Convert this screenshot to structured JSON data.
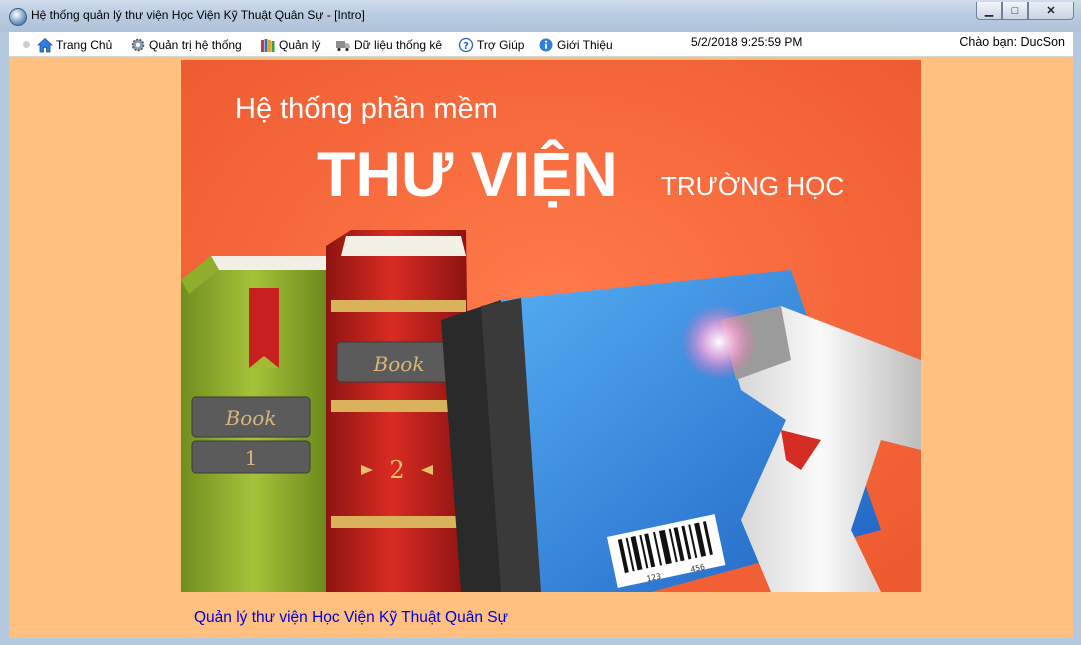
{
  "window": {
    "title": "Hệ thống quản lý thư viện Học Viện Kỹ Thuật Quân Sự - [Intro]",
    "minimize_glyph": "▁",
    "maximize_glyph": "□",
    "close_glyph": "✕"
  },
  "menu": {
    "items": [
      {
        "label": "Trang Chủ",
        "icon": "home-icon"
      },
      {
        "label": "Quản trị hệ thống",
        "icon": "gear-icon"
      },
      {
        "label": "Quản lý",
        "icon": "books-icon"
      },
      {
        "label": "Dữ liệu thống kê",
        "icon": "truck-icon"
      },
      {
        "label": "Trợ Giúp",
        "icon": "help-icon"
      },
      {
        "label": "Giới Thiệu",
        "icon": "info-icon"
      }
    ],
    "datetime": "5/2/2018 9:25:59 PM",
    "greeting": "Chào bạn: DucSon"
  },
  "banner": {
    "line1": "Hệ thống phần mềm",
    "line2": "THƯ VIỆN",
    "line3": "TRƯỜNG HỌC",
    "book_label": "Book",
    "book1_number": "1",
    "book2_number": "2",
    "barcode_left": "123",
    "barcode_right": "456"
  },
  "footer": {
    "text": "Quản lý thư viện Học Viện Kỹ Thuật Quân Sự"
  },
  "colors": {
    "content_bg": "#ffc080",
    "banner_bg": "#f5653a",
    "footer_text": "#0000dd"
  }
}
